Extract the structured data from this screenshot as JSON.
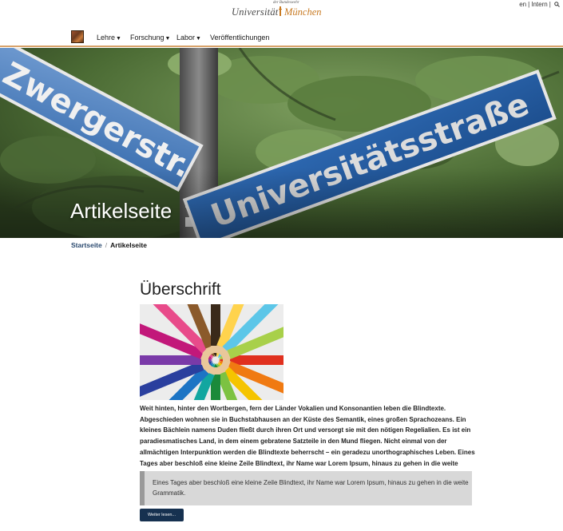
{
  "header": {
    "logo": {
      "small_text": "der Bundeswehr",
      "word1": "Universität",
      "word2": "München"
    },
    "lang_links": [
      "en",
      "Intern"
    ]
  },
  "nav": {
    "items": [
      {
        "label": "Lehre",
        "has_dropdown": true
      },
      {
        "label": "Forschung",
        "has_dropdown": true
      },
      {
        "label": "Labor",
        "has_dropdown": true
      },
      {
        "label": "Veröffentlichungen",
        "has_dropdown": false
      }
    ]
  },
  "hero": {
    "title": "Artikelseite",
    "sign_left_text": "Zwergerstr.",
    "sign_right_text": "Universitätsstraße"
  },
  "breadcrumb": {
    "home": "Startseite",
    "separator": "/",
    "current": "Artikelseite"
  },
  "article": {
    "headline": "Überschrift",
    "body": "Weit hinten, hinter den Wortbergen, fern der Länder Vokalien und Konsonantien leben die Blindtexte. Abgeschieden wohnen sie in Buchstabhausen an der Küste des Semantik, eines großen Sprachozeans. Ein kleines Bächlein namens Duden fließt durch ihren Ort und versorgt sie mit den nötigen Regelialien. Es ist ein paradiesmatisches Land, in dem einem gebratene Satzteile in den Mund fliegen. Nicht einmal von der allmächtigen Interpunktion werden die Blindtexte beherrscht – ein geradezu unorthographisches Leben. Eines Tages aber beschloß eine kleine Zeile Blindtext, ihr Name war Lorem Ipsum, hinaus zu gehen in die weite Grammatik.",
    "quote": "Eines Tages aber beschloß eine kleine Zeile Blindtext, ihr Name war Lorem Ipsum, hinaus zu gehen in die weite Grammatik.",
    "button_label": "Weiter lesen..."
  },
  "colors": {
    "nav_underline": "#d9a36b",
    "button_bg": "#163150",
    "breadcrumb_link": "#2b4a6f",
    "logo_accent": "#c87a22",
    "quote_bg": "#d8d8d8",
    "quote_border": "#9a9a9a"
  }
}
